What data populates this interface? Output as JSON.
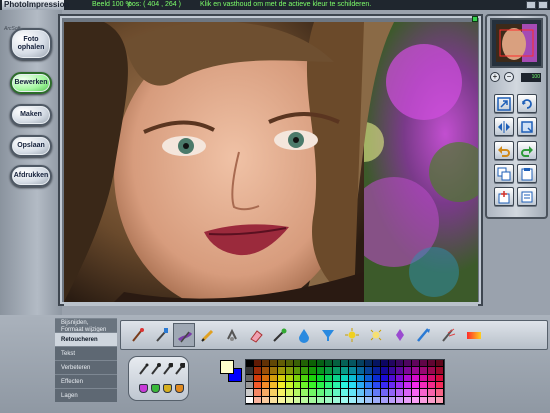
{
  "titlebar": {
    "app_title": "PhotoImpression",
    "zoom_label": "Beeld 100 %",
    "position_label": "pos: ( 404 , 264 )",
    "hint": "Klik en vasthoud om met de actieve kleur te schilderen."
  },
  "logo": "ArcSoft",
  "left_menu": {
    "items": [
      {
        "label": "Foto ophalen",
        "active": false
      },
      {
        "label": "Bewerken",
        "active": true
      },
      {
        "label": "Maken",
        "active": false
      },
      {
        "label": "Opslaan",
        "active": false
      },
      {
        "label": "Afdrukken",
        "active": false
      }
    ]
  },
  "right_panel": {
    "zoom_value": "100",
    "buttons": [
      "fit-icon",
      "rotate-icon",
      "flip-icon",
      "crop-icon",
      "undo-icon",
      "redo-icon",
      "copy-icon",
      "paste-icon",
      "new-layer-icon",
      "layer-properties-icon"
    ]
  },
  "bottom_tabs": {
    "items": [
      {
        "label": "Bijsnijden,\nFormaat wijzigen",
        "active": false
      },
      {
        "label": "Retoucheren",
        "active": true
      },
      {
        "label": "Tekst",
        "active": false
      },
      {
        "label": "Verbeteren",
        "active": false
      },
      {
        "label": "Effecten",
        "active": false
      },
      {
        "label": "Lagen",
        "active": false
      }
    ]
  },
  "retouch_tools": [
    "paintbrush-icon",
    "eyedropper-icon",
    "smear-icon",
    "pencil-icon",
    "clone-icon",
    "eraser-icon",
    "airbrush-icon",
    "water-drop-icon",
    "funnel-icon",
    "lighten-icon",
    "darken-icon",
    "contrast-icon",
    "sharpen-icon",
    "blend-icon",
    "gradient-icon"
  ],
  "selected_tool": "smear-icon",
  "colors": {
    "foreground": "#ffffcc",
    "background": "#0000ff",
    "accent_green": "#7dff6a",
    "active_button": "#a4f8a0"
  }
}
